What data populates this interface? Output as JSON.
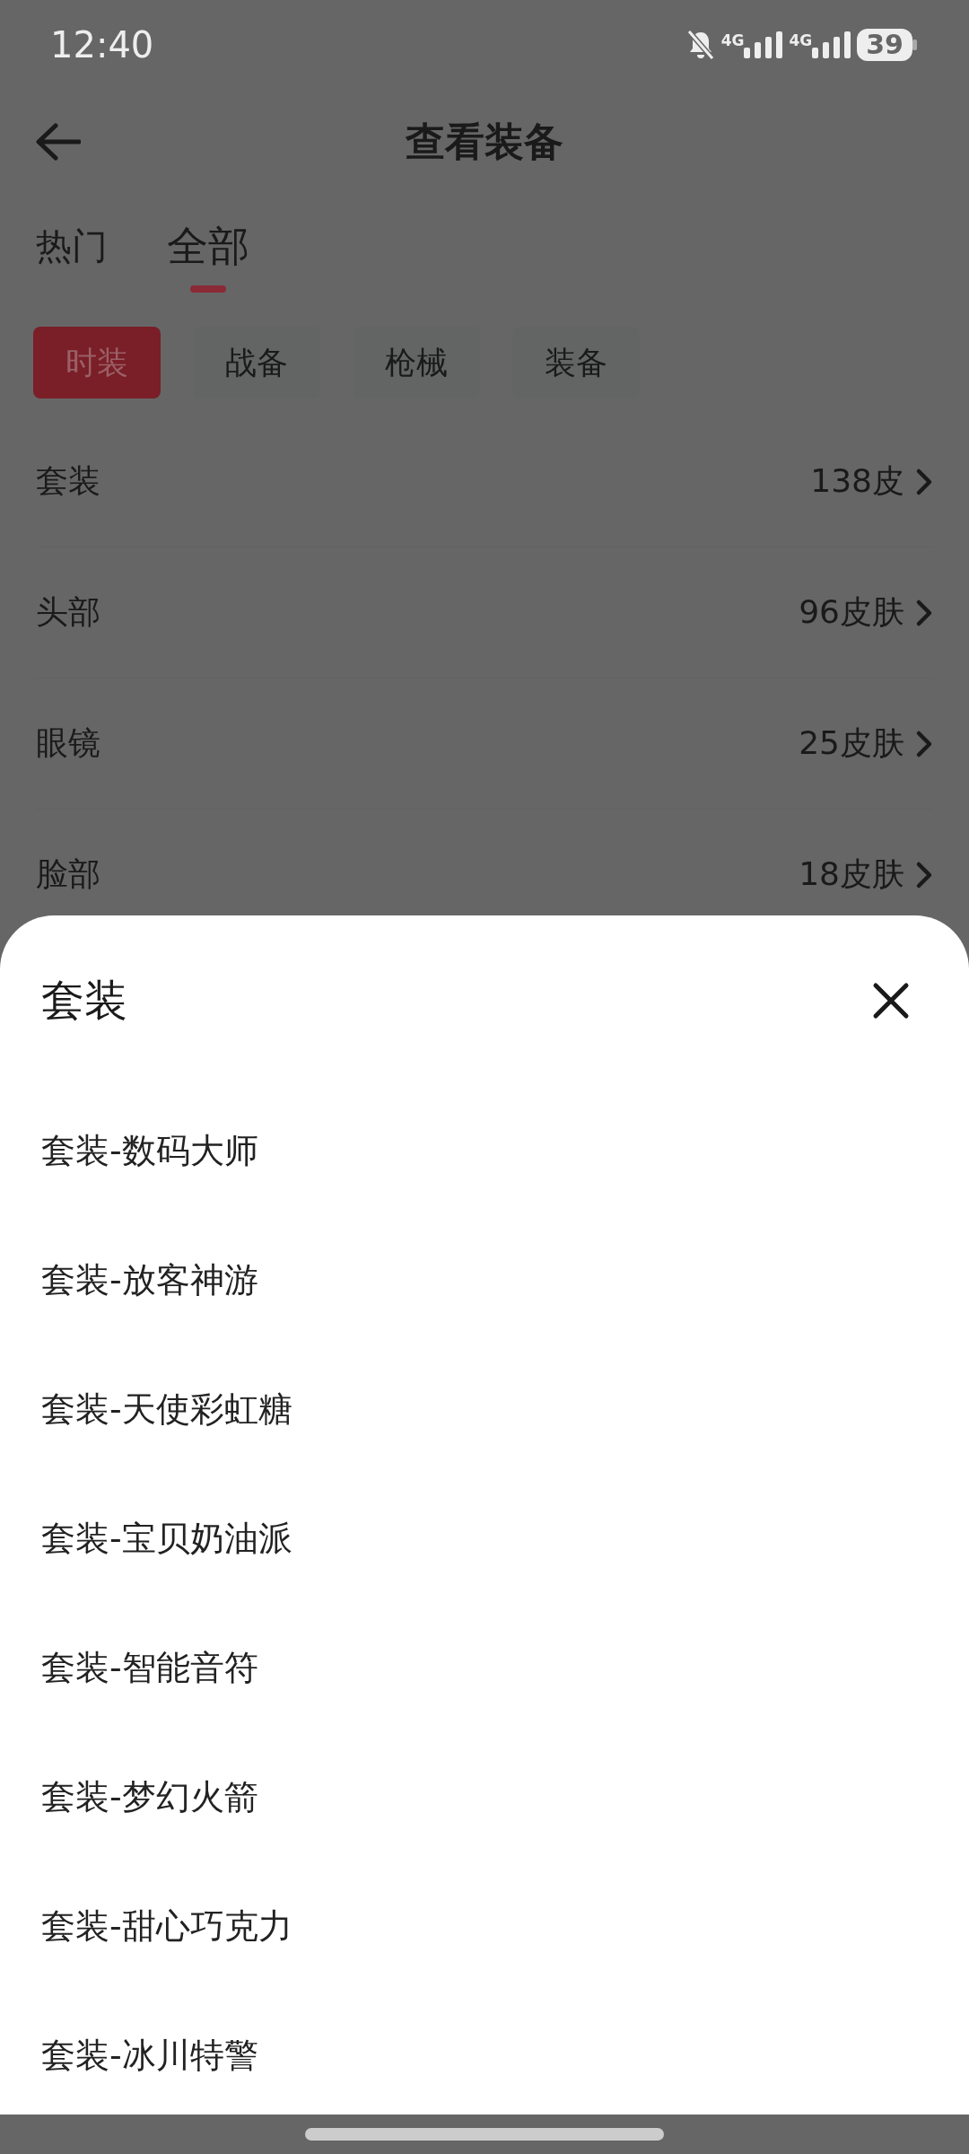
{
  "status_bar": {
    "time": "12:40",
    "networks": [
      "4G",
      "4G"
    ],
    "battery": "39"
  },
  "header": {
    "title": "查看装备"
  },
  "tabs": [
    {
      "label": "热门",
      "selected": false
    },
    {
      "label": "全部",
      "selected": true
    }
  ],
  "chips": [
    {
      "label": "时装",
      "selected": true
    },
    {
      "label": "战备",
      "selected": false
    },
    {
      "label": "枪械",
      "selected": false
    },
    {
      "label": "装备",
      "selected": false
    }
  ],
  "categories": [
    {
      "name": "套装",
      "count": "138皮"
    },
    {
      "name": "头部",
      "count": "96皮肤"
    },
    {
      "name": "眼镜",
      "count": "25皮肤"
    },
    {
      "name": "脸部",
      "count": "18皮肤"
    }
  ],
  "sheet": {
    "title": "套装",
    "items": [
      "套装-数码大师",
      "套装-放客神游",
      "套装-天使彩虹糖",
      "套装-宝贝奶油派",
      "套装-智能音符",
      "套装-梦幻火箭",
      "套装-甜心巧克力",
      "套装-冰川特警"
    ]
  }
}
